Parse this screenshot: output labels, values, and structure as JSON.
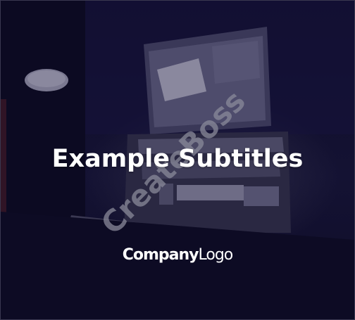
{
  "subtitle": "Example Subtitles",
  "logo": {
    "bold_part": "Company",
    "light_part": "Logo"
  },
  "watermark": "CreateBoss",
  "colors": {
    "background": "#0e0c28",
    "text": "#ffffff",
    "watermark": "#8a8a9a"
  }
}
